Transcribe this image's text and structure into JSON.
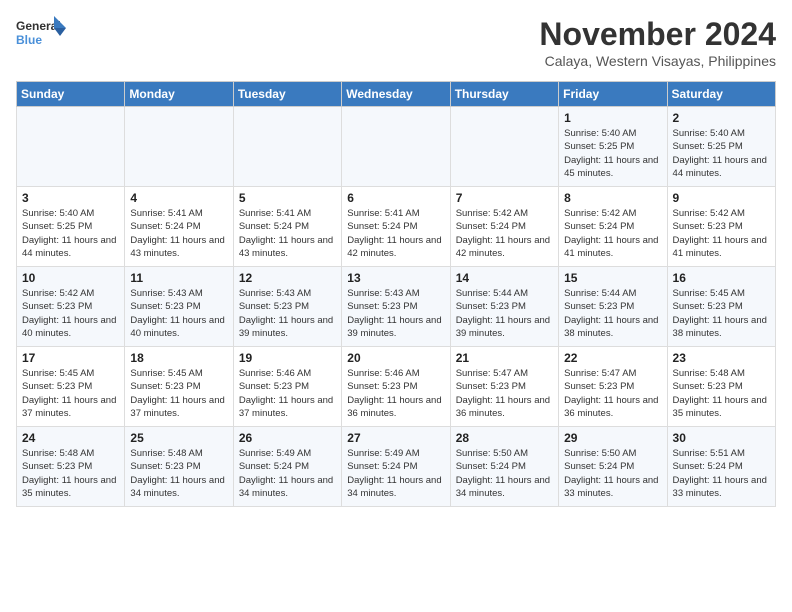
{
  "logo": {
    "line1": "General",
    "line2": "Blue"
  },
  "title": "November 2024",
  "location": "Calaya, Western Visayas, Philippines",
  "weekdays": [
    "Sunday",
    "Monday",
    "Tuesday",
    "Wednesday",
    "Thursday",
    "Friday",
    "Saturday"
  ],
  "weeks": [
    [
      {
        "day": "",
        "info": ""
      },
      {
        "day": "",
        "info": ""
      },
      {
        "day": "",
        "info": ""
      },
      {
        "day": "",
        "info": ""
      },
      {
        "day": "",
        "info": ""
      },
      {
        "day": "1",
        "info": "Sunrise: 5:40 AM\nSunset: 5:25 PM\nDaylight: 11 hours and 45 minutes."
      },
      {
        "day": "2",
        "info": "Sunrise: 5:40 AM\nSunset: 5:25 PM\nDaylight: 11 hours and 44 minutes."
      }
    ],
    [
      {
        "day": "3",
        "info": "Sunrise: 5:40 AM\nSunset: 5:25 PM\nDaylight: 11 hours and 44 minutes."
      },
      {
        "day": "4",
        "info": "Sunrise: 5:41 AM\nSunset: 5:24 PM\nDaylight: 11 hours and 43 minutes."
      },
      {
        "day": "5",
        "info": "Sunrise: 5:41 AM\nSunset: 5:24 PM\nDaylight: 11 hours and 43 minutes."
      },
      {
        "day": "6",
        "info": "Sunrise: 5:41 AM\nSunset: 5:24 PM\nDaylight: 11 hours and 42 minutes."
      },
      {
        "day": "7",
        "info": "Sunrise: 5:42 AM\nSunset: 5:24 PM\nDaylight: 11 hours and 42 minutes."
      },
      {
        "day": "8",
        "info": "Sunrise: 5:42 AM\nSunset: 5:24 PM\nDaylight: 11 hours and 41 minutes."
      },
      {
        "day": "9",
        "info": "Sunrise: 5:42 AM\nSunset: 5:23 PM\nDaylight: 11 hours and 41 minutes."
      }
    ],
    [
      {
        "day": "10",
        "info": "Sunrise: 5:42 AM\nSunset: 5:23 PM\nDaylight: 11 hours and 40 minutes."
      },
      {
        "day": "11",
        "info": "Sunrise: 5:43 AM\nSunset: 5:23 PM\nDaylight: 11 hours and 40 minutes."
      },
      {
        "day": "12",
        "info": "Sunrise: 5:43 AM\nSunset: 5:23 PM\nDaylight: 11 hours and 39 minutes."
      },
      {
        "day": "13",
        "info": "Sunrise: 5:43 AM\nSunset: 5:23 PM\nDaylight: 11 hours and 39 minutes."
      },
      {
        "day": "14",
        "info": "Sunrise: 5:44 AM\nSunset: 5:23 PM\nDaylight: 11 hours and 39 minutes."
      },
      {
        "day": "15",
        "info": "Sunrise: 5:44 AM\nSunset: 5:23 PM\nDaylight: 11 hours and 38 minutes."
      },
      {
        "day": "16",
        "info": "Sunrise: 5:45 AM\nSunset: 5:23 PM\nDaylight: 11 hours and 38 minutes."
      }
    ],
    [
      {
        "day": "17",
        "info": "Sunrise: 5:45 AM\nSunset: 5:23 PM\nDaylight: 11 hours and 37 minutes."
      },
      {
        "day": "18",
        "info": "Sunrise: 5:45 AM\nSunset: 5:23 PM\nDaylight: 11 hours and 37 minutes."
      },
      {
        "day": "19",
        "info": "Sunrise: 5:46 AM\nSunset: 5:23 PM\nDaylight: 11 hours and 37 minutes."
      },
      {
        "day": "20",
        "info": "Sunrise: 5:46 AM\nSunset: 5:23 PM\nDaylight: 11 hours and 36 minutes."
      },
      {
        "day": "21",
        "info": "Sunrise: 5:47 AM\nSunset: 5:23 PM\nDaylight: 11 hours and 36 minutes."
      },
      {
        "day": "22",
        "info": "Sunrise: 5:47 AM\nSunset: 5:23 PM\nDaylight: 11 hours and 36 minutes."
      },
      {
        "day": "23",
        "info": "Sunrise: 5:48 AM\nSunset: 5:23 PM\nDaylight: 11 hours and 35 minutes."
      }
    ],
    [
      {
        "day": "24",
        "info": "Sunrise: 5:48 AM\nSunset: 5:23 PM\nDaylight: 11 hours and 35 minutes."
      },
      {
        "day": "25",
        "info": "Sunrise: 5:48 AM\nSunset: 5:23 PM\nDaylight: 11 hours and 34 minutes."
      },
      {
        "day": "26",
        "info": "Sunrise: 5:49 AM\nSunset: 5:24 PM\nDaylight: 11 hours and 34 minutes."
      },
      {
        "day": "27",
        "info": "Sunrise: 5:49 AM\nSunset: 5:24 PM\nDaylight: 11 hours and 34 minutes."
      },
      {
        "day": "28",
        "info": "Sunrise: 5:50 AM\nSunset: 5:24 PM\nDaylight: 11 hours and 34 minutes."
      },
      {
        "day": "29",
        "info": "Sunrise: 5:50 AM\nSunset: 5:24 PM\nDaylight: 11 hours and 33 minutes."
      },
      {
        "day": "30",
        "info": "Sunrise: 5:51 AM\nSunset: 5:24 PM\nDaylight: 11 hours and 33 minutes."
      }
    ]
  ]
}
